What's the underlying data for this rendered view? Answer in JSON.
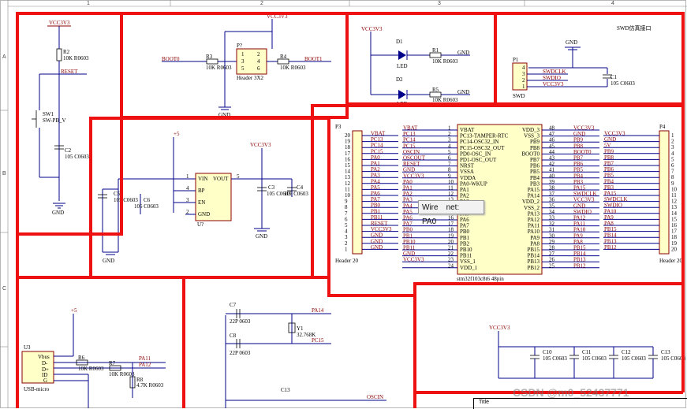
{
  "tooltip": {
    "kind": "Wire",
    "net": "net: PA0"
  },
  "watermark": "CSDN @m0_52437771",
  "title_block_label": "Title",
  "grid": {
    "cols": [
      "1",
      "2",
      "3",
      "4"
    ],
    "rows": [
      "A",
      "B",
      "C"
    ]
  },
  "section_swd": "SWD仿真接口",
  "reset": {
    "vcc": "VCC3V3",
    "r2": "R2",
    "r2_val": "10K R0603",
    "net": "RESET",
    "sw": "SW1",
    "sw_val": "SW-PB_V",
    "c2": "C2",
    "c2_val": "105 C0603",
    "gnd": "GND"
  },
  "boot": {
    "vcc": "VCC3V3",
    "boot0": "BOOT0",
    "boot1": "BOOT1",
    "r3": "R3",
    "r3_val": "10K R0603",
    "r4": "R4",
    "r4_val": "10K R0603",
    "p": "P?",
    "p_val": "Header 3X2",
    "gnd": "GND",
    "pins": [
      "1",
      "2",
      "3",
      "4",
      "5",
      "6"
    ]
  },
  "led": {
    "vcc": "VCC3V3",
    "d1": "D1",
    "d2": "D2",
    "led": "LED",
    "r1": "R1",
    "r5": "R5",
    "r_val": "10K R0603",
    "gnd": "GND"
  },
  "swd": {
    "p1": "P1",
    "label": "SWD",
    "pins": [
      "4",
      "3",
      "2",
      "1"
    ],
    "nets": [
      "SWDCLK",
      "SWDIO",
      "VCC3V3"
    ],
    "gnd": "GND",
    "c1": "C1",
    "c1_val": "105 C0603"
  },
  "ldo": {
    "vin": "+5",
    "vcc": "VCC3V3",
    "pins_l": [
      "VIN",
      "BP",
      "EN",
      "GND"
    ],
    "pins_r": [
      "VOUT"
    ],
    "nums": [
      "1",
      "4",
      "3",
      "2",
      "5"
    ],
    "u": "U?",
    "c3": "C3",
    "c4": "C4",
    "c5": "C5",
    "c6": "C6",
    "c_val": "105 C0603",
    "gnd": "GND"
  },
  "p3": {
    "name": "P3",
    "label": "Header 20",
    "nums": [
      "20",
      "19",
      "18",
      "17",
      "16",
      "15",
      "14",
      "13",
      "12",
      "11",
      "10",
      "9",
      "8",
      "7",
      "6",
      "5",
      "4",
      "3",
      "2",
      "1"
    ],
    "nets": [
      "VBAT",
      "PC13",
      "PC14",
      "PC15",
      "PA0",
      "PA1",
      "PA2",
      "PA3",
      "PA4",
      "PA5",
      "PA6",
      "PA7",
      "PB0",
      "PB1",
      "PB11",
      "RESET",
      "VCC3V3",
      "GND",
      "GND",
      "GND"
    ]
  },
  "mcu": {
    "name": "stm32f103c8t6 48pin",
    "left_nets": [
      "VBAT",
      "PC13",
      "PC14",
      "PC15",
      "OSCIN",
      "OSCOUT",
      "RESET",
      "GND",
      "VCC3V3",
      "PA0",
      "PA1",
      "PA2",
      "PA3",
      "PA4",
      "PA5",
      "PA6",
      "PA7",
      "PB0",
      "PB1",
      "PB10",
      "PB11",
      "GND",
      "VCC3V3"
    ],
    "left_pins": [
      "VBAT",
      "PC13-TAMPER-RTC",
      "PC14-OSC32_IN",
      "PC15-OSC32_OUT",
      "PD0-OSC_IN",
      "PD1-OSC_OUT",
      "NRST",
      "VSSA",
      "VDDA",
      "PA0-WKUP",
      "PA1",
      "PA2",
      "PA3",
      "PA4",
      "PA5",
      "PA6",
      "PA7",
      "PB0",
      "PB1",
      "PB2",
      "PB10",
      "PB11",
      "VSS_1",
      "VDD_1"
    ],
    "left_nums": [
      "1",
      "2",
      "3",
      "4",
      "5",
      "6",
      "7",
      "8",
      "9",
      "10",
      "11",
      "12",
      "13",
      "14",
      "15",
      "16",
      "17",
      "18",
      "19",
      "20",
      "21",
      "22",
      "23",
      "24"
    ],
    "right_pins": [
      "VDD_3",
      "VSS_3",
      "PB9",
      "PB8",
      "BOOT0",
      "PB7",
      "PB6",
      "PB5",
      "PB4",
      "PB3",
      "PA15",
      "PA14",
      "VDD_2",
      "VSS_2",
      "PA13",
      "PA12",
      "PA11",
      "PA10",
      "PA9",
      "PA8",
      "PB15",
      "PB14",
      "PB13",
      "PB12"
    ],
    "right_nums": [
      "48",
      "47",
      "46",
      "45",
      "44",
      "43",
      "42",
      "41",
      "40",
      "39",
      "38",
      "37",
      "36",
      "35",
      "34",
      "33",
      "32",
      "31",
      "30",
      "29",
      "28",
      "27",
      "26",
      "25"
    ],
    "right_nets": [
      "VCC3V3",
      "GND",
      "PB9",
      "PB8",
      "BOOT0",
      "PB7",
      "PB6",
      "PB5",
      "PB4",
      "PB3",
      "PA15",
      "SWDCLK",
      "VCC3V3",
      "GND",
      "SWDIO",
      "PA12",
      "PA11",
      "PA10",
      "PA9",
      "PA8",
      "PB15",
      "PB14",
      "PB13",
      "PB12"
    ]
  },
  "p4": {
    "name": "P4",
    "label": "Header 20",
    "nums": [
      "1",
      "2",
      "3",
      "4",
      "5",
      "6",
      "7",
      "8",
      "9",
      "10",
      "11",
      "12",
      "13",
      "14",
      "15",
      "16",
      "17",
      "18",
      "19",
      "20"
    ],
    "nets": [
      "VCC3V3",
      "GND",
      "5V",
      "PB9",
      "PB8",
      "PB7",
      "PB6",
      "PB5",
      "PB4",
      "PB3",
      "PA15",
      "SWDCLK",
      "SWDIO",
      "PA10",
      "PA9",
      "PA8",
      "PB15",
      "PB14",
      "PB13",
      "PB12"
    ]
  },
  "usb": {
    "u": "U3",
    "label": "USB-micro",
    "pins": [
      "Vbus",
      "D-",
      "D+",
      "ID",
      "G"
    ],
    "vin": "+5",
    "r6": "R6",
    "r6_val": "10K R0603",
    "r7": "R7",
    "r7_val": "10K R0603",
    "r8": "R8",
    "r8_val": "4.7K R0603",
    "pa11": "PA11",
    "pa12": "PA12"
  },
  "osc": {
    "c7": "C7",
    "c8": "C8",
    "c_val": "22P 0603",
    "y1": "Y1",
    "y_val": "32.768K",
    "pa14": "PA14",
    "pc15": "PC15",
    "c13": "C13",
    "oscin": "OSCIN"
  },
  "decoup": {
    "vcc": "VCC3V3",
    "caps": [
      "C10",
      "C11",
      "C12",
      "C13"
    ],
    "val": "105 C0603"
  }
}
